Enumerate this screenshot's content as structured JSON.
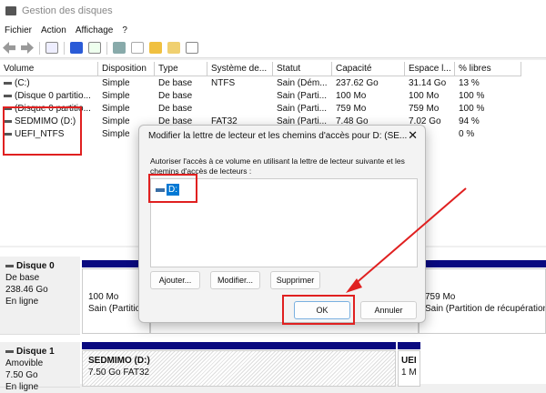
{
  "window": {
    "title": "Gestion des disques"
  },
  "menu": [
    "Fichier",
    "Action",
    "Affichage",
    "?"
  ],
  "table": {
    "columns": [
      "Volume",
      "Disposition",
      "Type",
      "Système de...",
      "Statut",
      "Capacité",
      "Espace l...",
      "% libres"
    ],
    "rows": [
      [
        "(C:)",
        "Simple",
        "De base",
        "NTFS",
        "Sain (Dém...",
        "237.62 Go",
        "31.14 Go",
        "13 %"
      ],
      [
        "(Disque 0 partitio...",
        "Simple",
        "De base",
        "",
        "Sain (Parti...",
        "100 Mo",
        "100 Mo",
        "100 %"
      ],
      [
        "(Disque 0 partitio...",
        "Simple",
        "De base",
        "",
        "Sain (Parti...",
        "759 Mo",
        "759 Mo",
        "100 %"
      ],
      [
        "SEDMIMO (D:)",
        "Simple",
        "De base",
        "FAT32",
        "Sain (Parti...",
        "7.48 Go",
        "7.02 Go",
        "94 %"
      ],
      [
        "UEFI_NTFS",
        "Simple",
        "",
        "",
        "",
        "",
        "",
        "0 %"
      ]
    ]
  },
  "disks": [
    {
      "name": "Disque 0",
      "type": "De base",
      "size": "238.46 Go",
      "status": "En ligne",
      "partitions": [
        {
          "size": "100 Mo",
          "status": "Sain (Partitio"
        },
        {
          "size": "759 Mo",
          "status": "Sain (Partition de récupération"
        }
      ]
    },
    {
      "name": "Disque 1",
      "type": "Amovible",
      "size": "7.50 Go",
      "status": "En ligne",
      "partitions": [
        {
          "name": "SEDMIMO  (D:)",
          "size": "7.50 Go FAT32"
        },
        {
          "name": "UEI",
          "size": "1 M"
        }
      ]
    }
  ],
  "dialog": {
    "title": "Modifier la lettre de lecteur et les chemins d'accès pour D: (SE...",
    "description": "Autoriser l'accès à ce volume en utilisant la lettre de lecteur suivante et les chemins d'accès de lecteurs :",
    "entry": "D:",
    "add": "Ajouter...",
    "modify": "Modifier...",
    "remove": "Supprimer",
    "ok": "OK",
    "cancel": "Annuler"
  },
  "colors": {
    "accent": "#0078d4",
    "highlight": "#e02020",
    "disk_bar": "#0a0a80"
  }
}
